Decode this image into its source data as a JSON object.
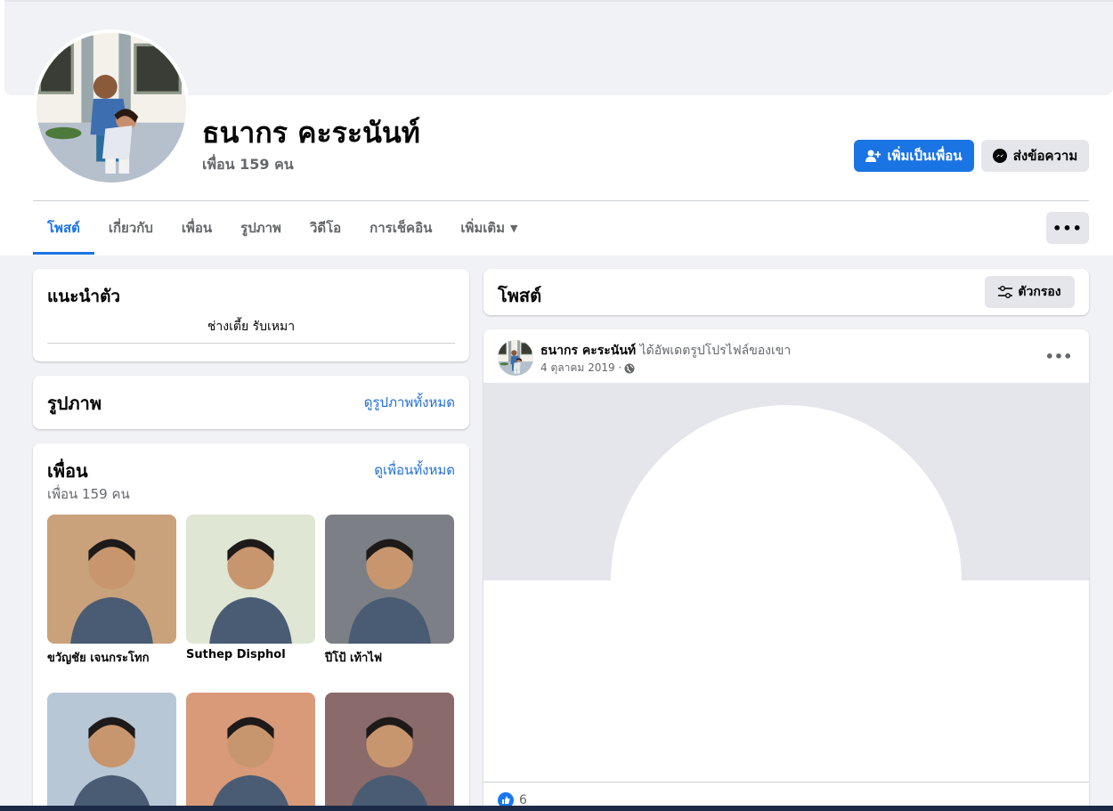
{
  "profile": {
    "name": "ธนากร คะระนันท์",
    "friends_count": "เพื่อน 159 คน"
  },
  "actions": {
    "add_friend": "เพิ่มเป็นเพื่อน",
    "message": "ส่งข้อความ"
  },
  "tabs": [
    {
      "label": "โพสต์",
      "active": true
    },
    {
      "label": "เกี่ยวกับ"
    },
    {
      "label": "เพื่อน"
    },
    {
      "label": "รูปภาพ"
    },
    {
      "label": "วิดีโอ"
    },
    {
      "label": "การเช็คอิน"
    },
    {
      "label": "เพิ่มเติม"
    }
  ],
  "intro": {
    "title": "แนะนำตัว",
    "bio": "ช่างเตี้ย รับเหมา"
  },
  "photos": {
    "title": "รูปภาพ",
    "see_all": "ดูรูปภาพทั้งหมด"
  },
  "friends": {
    "title": "เพื่อน",
    "count": "เพื่อน 159 คน",
    "see_all": "ดูเพื่อนทั้งหมด",
    "list": [
      {
        "name": "ขวัญชัย เจนกระโทก"
      },
      {
        "name": "Suthep Disphol"
      },
      {
        "name": "ปีโป้ เท้าไฟ"
      },
      {
        "name": ""
      },
      {
        "name": ""
      },
      {
        "name": ""
      }
    ]
  },
  "posts": {
    "title": "โพสต์",
    "filter": "ตัวกรอง",
    "items": [
      {
        "author": "ธนากร คะระนันท์",
        "action": "ได้อัพเดตรูปโปรไฟล์ของเขา",
        "date": "4 ตุลาคม 2019 · ",
        "likes": "6"
      }
    ]
  },
  "colors": {
    "accent": "#1b74e4",
    "background": "#f0f2f5",
    "secondary_button": "#e4e6eb",
    "muted_text": "#65676b"
  },
  "icons": [
    "add-friend-icon",
    "messenger-icon",
    "dropdown-caret-icon",
    "more-options-icon",
    "filter-icon",
    "globe-icon",
    "like-icon"
  ]
}
